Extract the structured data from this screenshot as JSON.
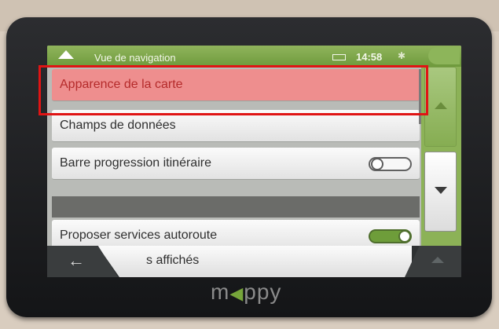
{
  "statusbar": {
    "title": "Vue de navigation",
    "time": "14:58",
    "bluetooth_icon": "bluetooth-icon",
    "battery_icon": "battery-icon"
  },
  "menu": {
    "items": [
      {
        "label": "Apparence de la carte",
        "selected": true
      },
      {
        "label": "Champs de données"
      },
      {
        "label": "Barre progression itinéraire",
        "toggle": "off"
      },
      {
        "label": "Proposer services autoroute",
        "toggle": "on"
      }
    ],
    "bottom_item": "s affichés"
  },
  "brand": {
    "left": "m",
    "mid": "◀",
    "right": "ppy"
  },
  "colors": {
    "accent_green": "#7aa548",
    "selection": "#ee8e8e",
    "highlight_outline": "#e01414"
  }
}
